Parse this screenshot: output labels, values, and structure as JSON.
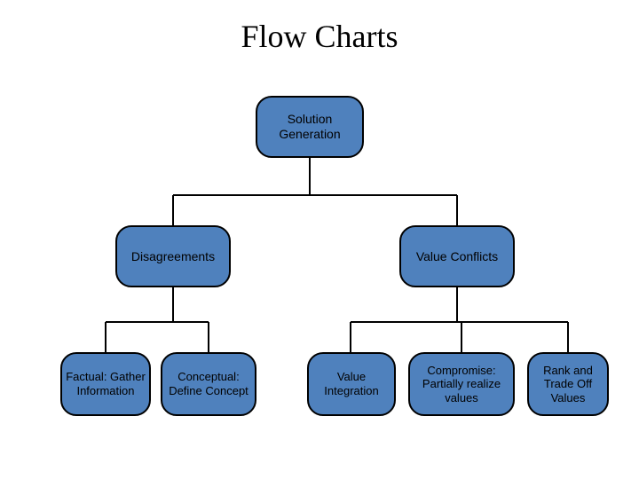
{
  "title": "Flow Charts",
  "nodes": {
    "root": "Solution Generation",
    "left": "Disagreements",
    "right": "Value Conflicts",
    "leaf1": "Factual: Gather Information",
    "leaf2": "Conceptual: Define Concept",
    "leaf3": "Value Integration",
    "leaf4": "Compromise: Partially realize values",
    "leaf5": "Rank and Trade Off Values"
  },
  "colors": {
    "node_fill": "#4f81bd",
    "node_border": "#000000",
    "connector": "#000000"
  }
}
